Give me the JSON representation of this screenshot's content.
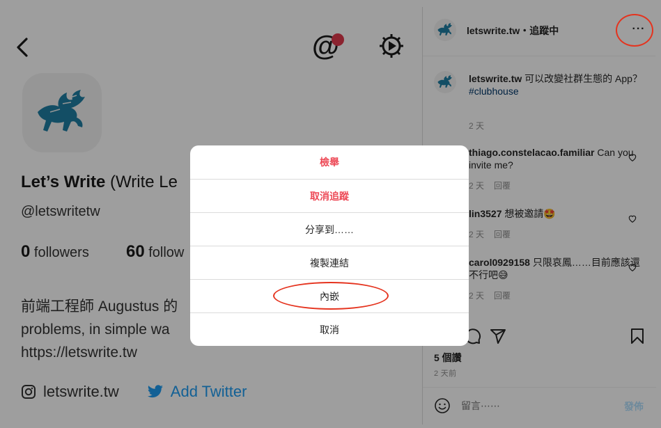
{
  "profile": {
    "name": "Let’s Write",
    "name_paren": "(Write Le",
    "handle": "@letswritetw",
    "followers_count": "0",
    "followers_label": "followers",
    "following_count": "60",
    "following_label": "follow",
    "bio_lines": [
      "前端工程師 Augustus 的",
      "problems, in simple wa",
      "https://letswrite.tw"
    ],
    "instagram": "letswrite.tw",
    "twitter": "Add Twitter",
    "mention_symbol": "@"
  },
  "post": {
    "username": "letswrite.tw",
    "following": "・追蹤中",
    "more_label": "···",
    "caption": {
      "username": "letswrite.tw",
      "text": " 可以改變社群生態的 App？",
      "hashtag": "#clubhouse",
      "time": "2 天"
    },
    "comments": [
      {
        "username": "thiago.constelacao.familiar",
        "text": " Can you invite me?",
        "time": "2 天",
        "reply": "回覆"
      },
      {
        "username": "lin3527",
        "text": " 想被邀請🤩",
        "time": "2 天",
        "reply": "回覆"
      },
      {
        "username": "carol0929158",
        "text": " 只限哀鳳……目前應該還不行吧😅",
        "time": "2 天",
        "reply": "回覆"
      }
    ],
    "likes": "5 個讚",
    "posted_ago": "2 天前",
    "comment_placeholder": "留言⋯⋯",
    "post_button": "發佈"
  },
  "modal": {
    "options": [
      "檢舉",
      "取消追蹤",
      "分享到……",
      "複製連結",
      "內嵌",
      "取消"
    ]
  },
  "colors": {
    "danger": "#ed4956",
    "annotation_red": "#e5331e",
    "twitter_blue": "#1d9bf0",
    "hashtag": "#00376b",
    "logo_teal": "#1f7fa3"
  }
}
